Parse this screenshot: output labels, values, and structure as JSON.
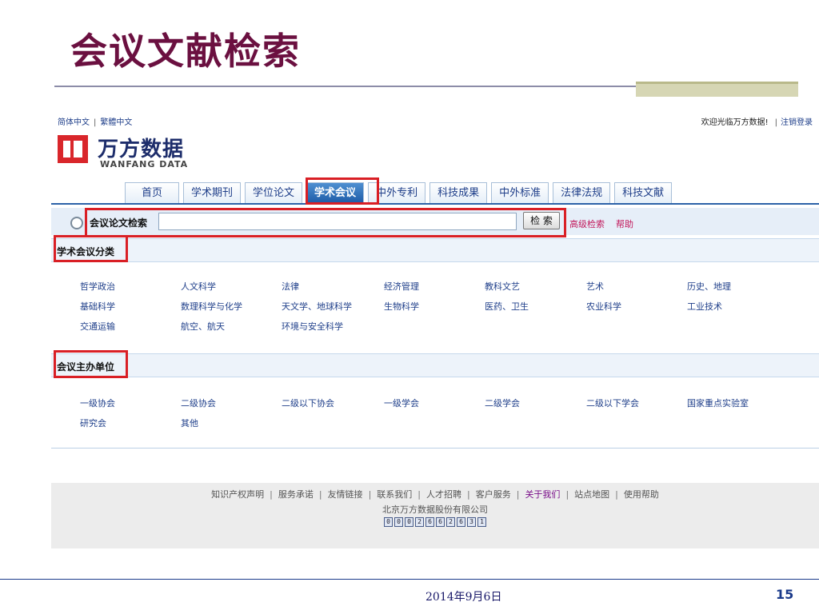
{
  "slide": {
    "title": "会议文献检索",
    "date": "2014年9月6日",
    "page_number": "15"
  },
  "header": {
    "lang_simplified": "简体中文",
    "lang_traditional": "繁體中文",
    "welcome": "欢迎光临万方数据!",
    "logout": "注销登录",
    "logo_cn": "万方数据",
    "logo_en": "WANFANG DATA"
  },
  "nav": {
    "tabs": [
      "首页",
      "学术期刊",
      "学位论文",
      "学术会议",
      "中外专利",
      "科技成果",
      "中外标准",
      "法律法规",
      "科技文献"
    ],
    "active": "学术会议"
  },
  "search": {
    "label": "会议论文检索",
    "placeholder": "",
    "button": "检 索",
    "advanced": "高级检索",
    "help": "帮助"
  },
  "categories": {
    "title": "学术会议分类",
    "items": [
      "哲学政治",
      "人文科学",
      "法律",
      "经济管理",
      "教科文艺",
      "艺术",
      "历史、地理",
      "基础科学",
      "数理科学与化学",
      "天文学、地球科学",
      "生物科学",
      "医药、卫生",
      "农业科学",
      "工业技术",
      "交通运输",
      "航空、航天",
      "环境与安全科学"
    ]
  },
  "organizers": {
    "title": "会议主办单位",
    "items": [
      "一级协会",
      "二级协会",
      "二级以下协会",
      "一级学会",
      "二级学会",
      "二级以下学会",
      "国家重点实验室",
      "研究会",
      "其他"
    ]
  },
  "footer": {
    "links": [
      "知识产权声明",
      "服务承诺",
      "友情链接",
      "联系我们",
      "人才招聘",
      "客户服务",
      "关于我们",
      "站点地图",
      "使用帮助"
    ],
    "highlight": "关于我们",
    "company": "北京万方数据股份有限公司",
    "counter": [
      "0",
      "0",
      "0",
      "2",
      "6",
      "6",
      "2",
      "6",
      "3",
      "1"
    ]
  },
  "colors": {
    "title": "#6b1040",
    "highlight_box": "#d91f25",
    "link": "#1f3f8a",
    "active_tab": "#1c5aa6"
  }
}
